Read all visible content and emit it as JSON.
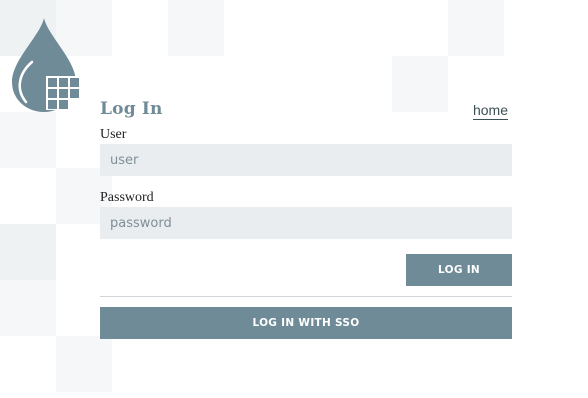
{
  "colors": {
    "accent": "#6f8b97",
    "input_background": "#e9edf0",
    "title_text": "#6f8b97",
    "label_text": "#1f1f1f",
    "link_text": "#3d4f57",
    "divider": "#cfd5d8",
    "background_tiles": [
      "#f5f7f8",
      "#eef2f3"
    ]
  },
  "logo": {
    "icon": "water-drop-grid-logo-icon"
  },
  "login": {
    "title": "Log In",
    "home_link": "home",
    "user_label": "User",
    "user_placeholder": "user",
    "user_value": "",
    "password_label": "Password",
    "password_placeholder": "password",
    "password_value": "",
    "login_button": "LOG IN",
    "sso_button": "LOG IN WITH SSO"
  }
}
